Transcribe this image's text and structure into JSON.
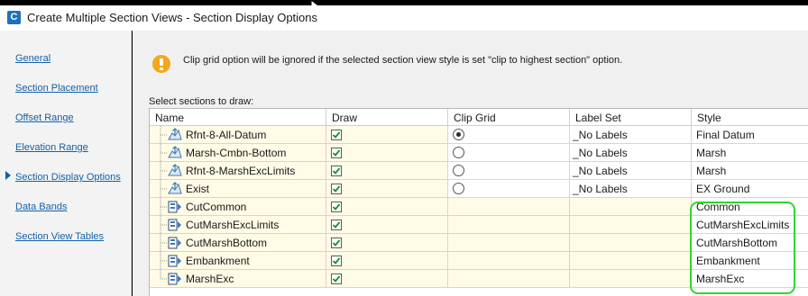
{
  "window": {
    "title": "Create Multiple Section Views - Section Display Options",
    "app_icon_letter": "C"
  },
  "sidebar": {
    "items": [
      {
        "label": "General",
        "active": false
      },
      {
        "label": "Section Placement",
        "active": false
      },
      {
        "label": "Offset Range",
        "active": false
      },
      {
        "label": "Elevation Range",
        "active": false
      },
      {
        "label": "Section Display Options",
        "active": true
      },
      {
        "label": "Data Bands",
        "active": false
      },
      {
        "label": "Section View Tables",
        "active": false
      }
    ]
  },
  "main": {
    "warning_text": "Clip grid option will be ignored if the selected section view style is set \"clip to highest section\" option.",
    "select_label": "Select sections to draw:",
    "columns": [
      "Name",
      "Draw",
      "Clip Grid",
      "Label Set",
      "Style"
    ],
    "rows": [
      {
        "name": "Rfnt-8-All-Datum",
        "icon": "surface-icon",
        "draw": true,
        "clip": "selected",
        "label_set": "_No Labels",
        "style": "Final Datum"
      },
      {
        "name": "Marsh-Cmbn-Bottom",
        "icon": "surface-icon",
        "draw": true,
        "clip": "unselected",
        "label_set": "_No Labels",
        "style": "Marsh"
      },
      {
        "name": "Rfnt-8-MarshExcLimits",
        "icon": "surface-icon",
        "draw": true,
        "clip": "unselected",
        "label_set": "_No Labels",
        "style": "Marsh"
      },
      {
        "name": "Exist",
        "icon": "surface-icon",
        "draw": true,
        "clip": "unselected",
        "label_set": "_No Labels",
        "style": "EX Ground"
      },
      {
        "name": "CutCommon",
        "icon": "material-icon",
        "draw": true,
        "clip": "",
        "label_set": "",
        "style": "Common"
      },
      {
        "name": "CutMarshExcLimits",
        "icon": "material-icon",
        "draw": true,
        "clip": "",
        "label_set": "",
        "style": "CutMarshExcLimits"
      },
      {
        "name": "CutMarshBottom",
        "icon": "material-icon",
        "draw": true,
        "clip": "",
        "label_set": "",
        "style": "CutMarshBottom"
      },
      {
        "name": "Embankment",
        "icon": "material-icon",
        "draw": true,
        "clip": "",
        "label_set": "",
        "style": "Embankment"
      },
      {
        "name": "MarshExc",
        "icon": "material-icon",
        "draw": true,
        "clip": "",
        "label_set": "",
        "style": "MarshExc"
      }
    ]
  },
  "colors": {
    "highlight": "#2fd62f",
    "link": "#1460a8",
    "warning": "#f2a81d",
    "row_editable": "#fffbe6"
  }
}
